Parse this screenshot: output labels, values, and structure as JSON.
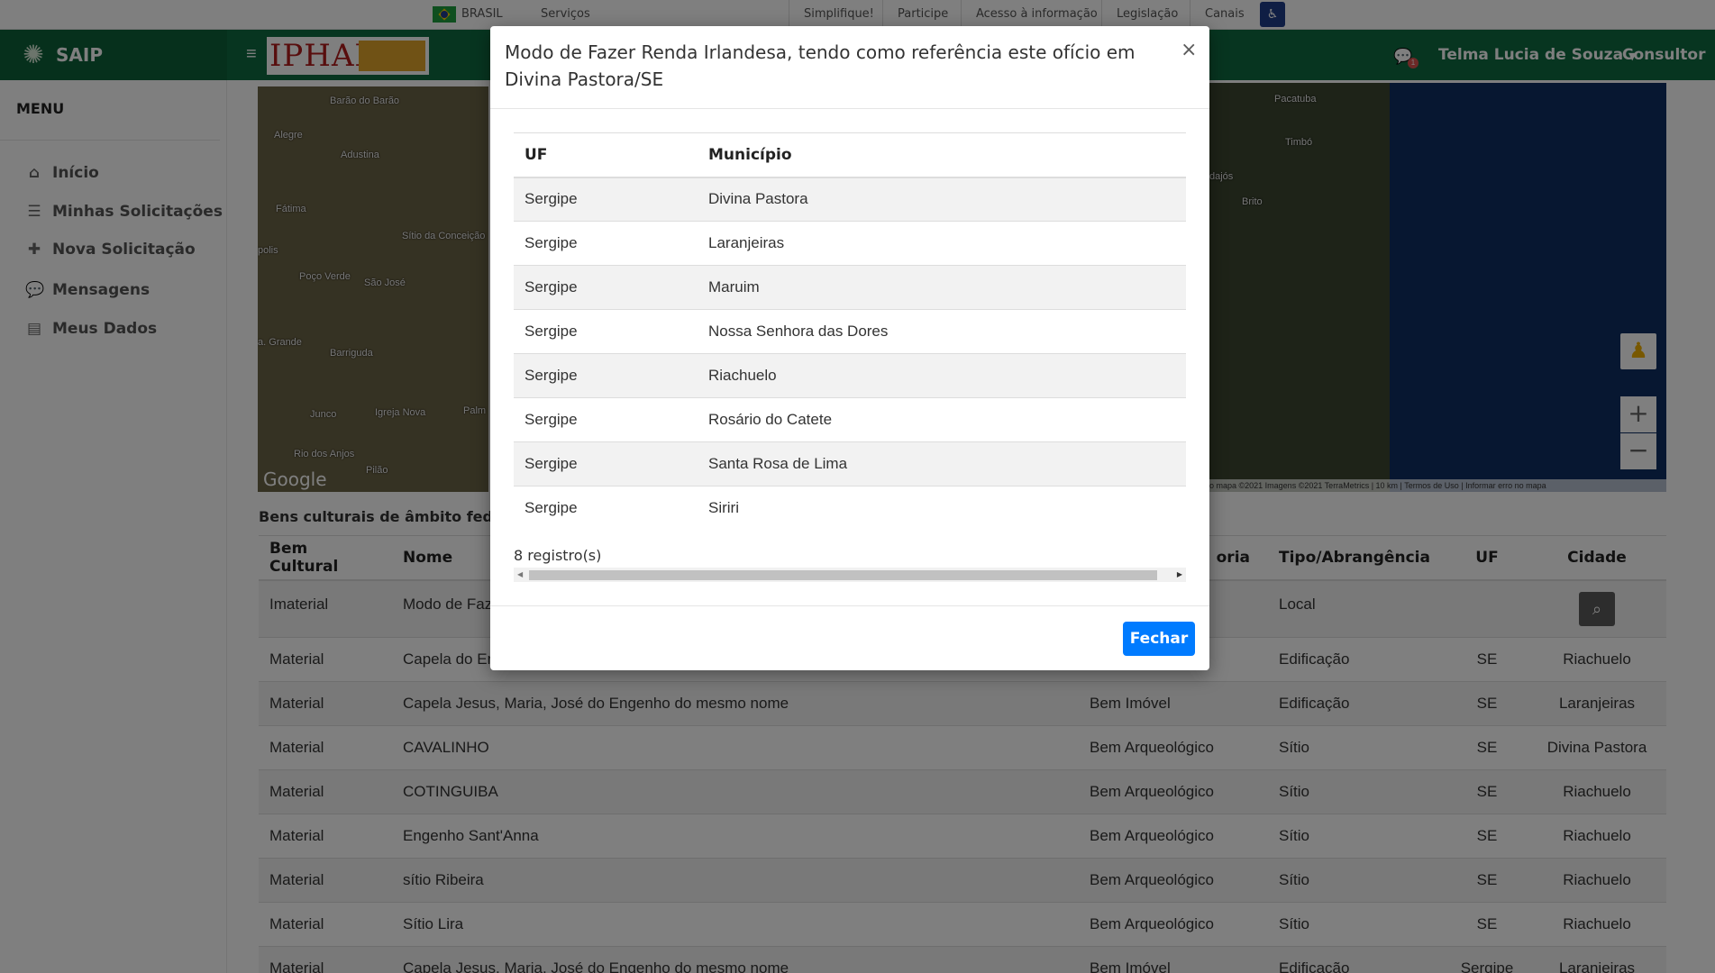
{
  "govbar": {
    "country": "BRASIL",
    "services": "Serviços",
    "links": [
      "Simplifique!",
      "Participe",
      "Acesso à informação",
      "Legislação",
      "Canais"
    ]
  },
  "header": {
    "app_name": "SAIP",
    "logo_text": "IPHAN",
    "notification_count": "1",
    "user_name": "Telma Lucia de Souza",
    "role": "Consultor"
  },
  "sidebar": {
    "title": "MENU",
    "items": [
      {
        "label": "Início",
        "icon": "home-icon"
      },
      {
        "label": "Minhas Solicitações",
        "icon": "list-icon"
      },
      {
        "label": "Nova Solicitação",
        "icon": "plus-icon"
      },
      {
        "label": "Mensagens",
        "icon": "comments-icon"
      },
      {
        "label": "Meus Dados",
        "icon": "file-icon"
      }
    ]
  },
  "map": {
    "labels_left": [
      "Barão do Barão",
      "Alegre",
      "Adustina",
      "Fátima",
      "Sítio da Conceição",
      "Poço Verde",
      "São José",
      "Barriguda",
      "Junco",
      "Igreja Nova",
      "Rio dos Anjos",
      "Pilão",
      "a. Grande",
      "Palm",
      "polis"
    ],
    "labels_right": [
      "Pacatuba",
      "Timbó",
      "Brito",
      "dajós"
    ],
    "google": "Google",
    "attribution": "o mapa ©2021 Imagens ©2021 TerraMetrics | 10 km | Termos de Uso | Informar erro no mapa"
  },
  "bens": {
    "title": "Bens culturais de âmbito federa",
    "columns": [
      "Bem Cultural",
      "Nome",
      "oria",
      "Tipo/Abrangência",
      "UF",
      "Cidade"
    ],
    "rows": [
      {
        "bem": "Imaterial",
        "nome": "Modo de Faze",
        "cat": "",
        "tipo": "Local",
        "uf": "",
        "cidade": ""
      },
      {
        "bem": "Material",
        "nome": "Capela do En",
        "cat": "",
        "tipo": "Edificação",
        "uf": "SE",
        "cidade": "Riachuelo"
      },
      {
        "bem": "Material",
        "nome": "Capela Jesus, Maria, José do Engenho do mesmo nome",
        "cat": "Bem Imóvel",
        "tipo": "Edificação",
        "uf": "SE",
        "cidade": "Laranjeiras"
      },
      {
        "bem": "Material",
        "nome": "CAVALINHO",
        "cat": "Bem Arqueológico",
        "tipo": "Sítio",
        "uf": "SE",
        "cidade": "Divina Pastora"
      },
      {
        "bem": "Material",
        "nome": "COTINGUIBA",
        "cat": "Bem Arqueológico",
        "tipo": "Sítio",
        "uf": "SE",
        "cidade": "Riachuelo"
      },
      {
        "bem": "Material",
        "nome": "Engenho Sant'Anna",
        "cat": "Bem Arqueológico",
        "tipo": "Sítio",
        "uf": "SE",
        "cidade": "Riachuelo"
      },
      {
        "bem": "Material",
        "nome": "sítio Ribeira",
        "cat": "Bem Arqueológico",
        "tipo": "Sítio",
        "uf": "SE",
        "cidade": "Riachuelo"
      },
      {
        "bem": "Material",
        "nome": "Sítio Lira",
        "cat": "Bem Arqueológico",
        "tipo": "Sítio",
        "uf": "SE",
        "cidade": "Riachuelo"
      },
      {
        "bem": "Material",
        "nome": "Capela Jesus, Maria, José do Engenho do mesmo nome",
        "cat": "Bem Imóvel",
        "tipo": "Edificação",
        "uf": "Sergipe",
        "cidade": "Laranjeiras"
      }
    ]
  },
  "modal": {
    "title": "Modo de Fazer Renda Irlandesa, tendo como referência este ofício em Divina Pastora/SE",
    "close": "×",
    "columns": [
      "UF",
      "Município"
    ],
    "rows": [
      {
        "uf": "Sergipe",
        "municipio": "Divina Pastora"
      },
      {
        "uf": "Sergipe",
        "municipio": "Laranjeiras"
      },
      {
        "uf": "Sergipe",
        "municipio": "Maruim"
      },
      {
        "uf": "Sergipe",
        "municipio": "Nossa Senhora das Dores"
      },
      {
        "uf": "Sergipe",
        "municipio": "Riachuelo"
      },
      {
        "uf": "Sergipe",
        "municipio": "Rosário do Catete"
      },
      {
        "uf": "Sergipe",
        "municipio": "Santa Rosa de Lima"
      },
      {
        "uf": "Sergipe",
        "municipio": "Siriri"
      }
    ],
    "count": "8 registro(s)",
    "button": "Fechar"
  }
}
